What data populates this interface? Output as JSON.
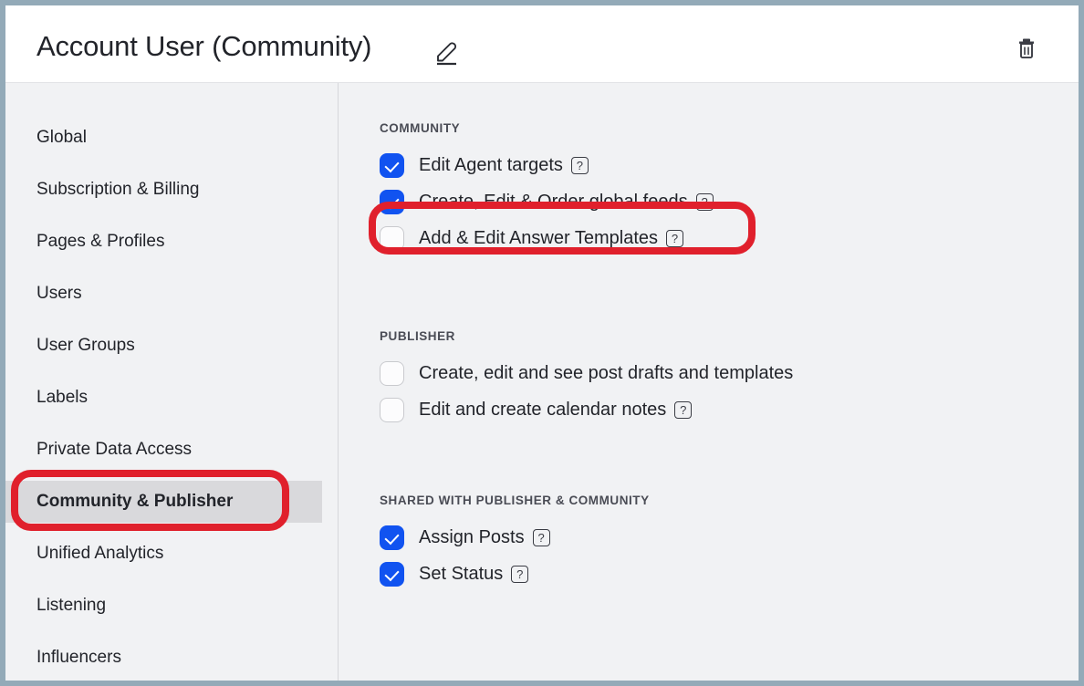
{
  "header": {
    "title": "Account User (Community)",
    "edit_icon": "pencil-edit-icon",
    "delete_icon": "trash-delete-icon"
  },
  "sidebar": {
    "items": [
      {
        "label": "Global",
        "selected": false
      },
      {
        "label": "Subscription & Billing",
        "selected": false
      },
      {
        "label": "Pages & Profiles",
        "selected": false
      },
      {
        "label": "Users",
        "selected": false
      },
      {
        "label": "User Groups",
        "selected": false
      },
      {
        "label": "Labels",
        "selected": false
      },
      {
        "label": "Private Data Access",
        "selected": false
      },
      {
        "label": "Community & Publisher",
        "selected": true
      },
      {
        "label": "Unified Analytics",
        "selected": false
      },
      {
        "label": "Listening",
        "selected": false
      },
      {
        "label": "Influencers",
        "selected": false
      }
    ]
  },
  "content": {
    "sections": [
      {
        "title": "COMMUNITY",
        "items": [
          {
            "label": "Edit Agent targets",
            "checked": true,
            "help": true
          },
          {
            "label": "Create, Edit & Order global feeds",
            "checked": true,
            "help": true
          },
          {
            "label": "Add & Edit Answer Templates",
            "checked": false,
            "help": true
          }
        ]
      },
      {
        "title": "PUBLISHER",
        "items": [
          {
            "label": "Create, edit and see post drafts and templates",
            "checked": false,
            "help": false
          },
          {
            "label": "Edit and create calendar notes",
            "checked": false,
            "help": true
          }
        ]
      },
      {
        "title": "SHARED WITH PUBLISHER & COMMUNITY",
        "items": [
          {
            "label": "Assign Posts",
            "checked": true,
            "help": true
          },
          {
            "label": "Set Status",
            "checked": true,
            "help": true
          }
        ]
      }
    ],
    "help_glyph": "?"
  },
  "annotations": {
    "color": "#e0202c",
    "sidebar_target": "Community & Publisher",
    "content_target": "Create, Edit & Order global feeds"
  },
  "colors": {
    "checkbox_on": "#1153f0",
    "frame": "#93aab8",
    "sidebar_selected_bg": "#d9d9dc",
    "page_bg": "#f1f2f4"
  }
}
